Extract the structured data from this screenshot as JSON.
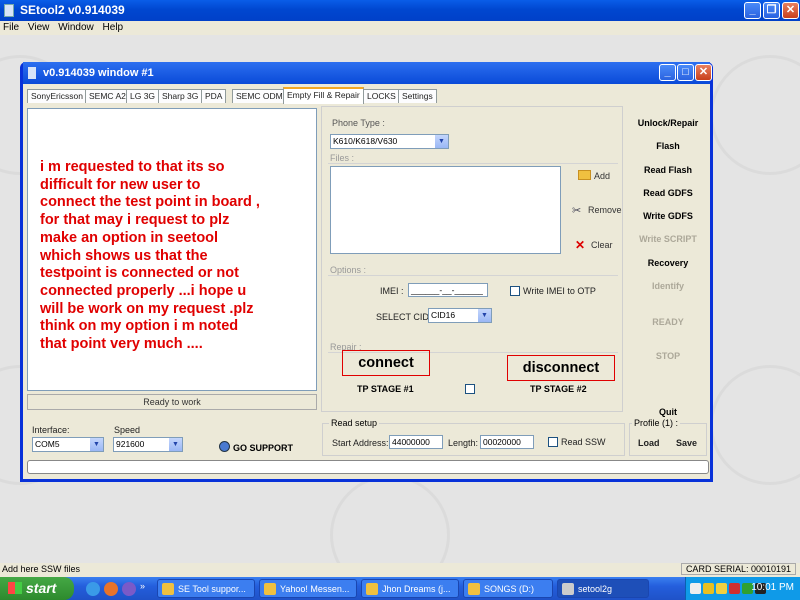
{
  "app": {
    "title": "SEtool2 v0.914039"
  },
  "menu": [
    "File",
    "View",
    "Window",
    "Help"
  ],
  "child_window": {
    "title": "v0.914039 window #1"
  },
  "tabs": [
    "SonyEricsson",
    "SEMC A2",
    "LG 3G",
    "Sharp 3G",
    "PDA",
    "SEMC ODM",
    "Empty Fill & Repair",
    "LOCKS",
    "Settings"
  ],
  "active_tab": "Empty Fill & Repair",
  "editor_lines": [
    "i m requested to that its so",
    "difficult  for new user to",
    "connect the test point in board ,",
    "for that may i request to plz",
    "make an option in seetool",
    "which shows us that the",
    "testpoint is connected or not",
    "connected properly ...i hope u",
    "will be work on my request .plz",
    "think on my option i m noted",
    "that point very much ...."
  ],
  "ready_status": "Ready to work",
  "phone_type": {
    "label": "Phone Type :",
    "value": "K610/K618/V630"
  },
  "files": {
    "label": "Files :",
    "add": "Add",
    "remove": "Remove",
    "clear": "Clear"
  },
  "options": {
    "label": "Options :",
    "imei_label": "IMEI :",
    "imei_value": "______-__-______",
    "write_imei": "Write IMEI to OTP",
    "cid_label": "SELECT CID:",
    "cid_value": "CID16"
  },
  "repair": {
    "label": "Repair :",
    "connect": "connect",
    "disconnect": "disconnect",
    "stage1": "TP STAGE #1",
    "stage2": "TP STAGE #2"
  },
  "actions": [
    {
      "label": "Unlock/Repair",
      "enabled": true
    },
    {
      "label": "Flash",
      "enabled": true
    },
    {
      "label": "Read Flash",
      "enabled": true
    },
    {
      "label": "Read GDFS",
      "enabled": true
    },
    {
      "label": "Write GDFS",
      "enabled": true
    },
    {
      "label": "Write SCRIPT",
      "enabled": false
    },
    {
      "label": "Recovery",
      "enabled": true
    },
    {
      "label": "Identify",
      "enabled": false
    },
    {
      "label": "READY",
      "enabled": false
    },
    {
      "label": "STOP",
      "enabled": false
    },
    {
      "label": "Quit",
      "enabled": true
    }
  ],
  "interface": {
    "label": "Interface:",
    "value": "COM5"
  },
  "speed": {
    "label": "Speed",
    "value": "921600"
  },
  "go_support": "GO SUPPORT",
  "read_setup": {
    "label": "Read setup",
    "start_label": "Start Address:",
    "start_value": "44000000",
    "length_label": "Length:",
    "length_value": "00020000",
    "read_ssw": "Read SSW"
  },
  "profile": {
    "label": "Profile (1) :",
    "load": "Load",
    "save": "Save"
  },
  "statusbar": {
    "left": "Add here SSW files",
    "right": "CARD SERIAL: 00010191"
  },
  "taskbar": {
    "start": "start",
    "tasks": [
      "SE Tool suppor...",
      "Yahoo! Messen...",
      "Jhon Dreams (j...",
      "SONGS (D:)",
      "setool2g"
    ],
    "active_task": "setool2g",
    "clock": "10:01 PM"
  }
}
